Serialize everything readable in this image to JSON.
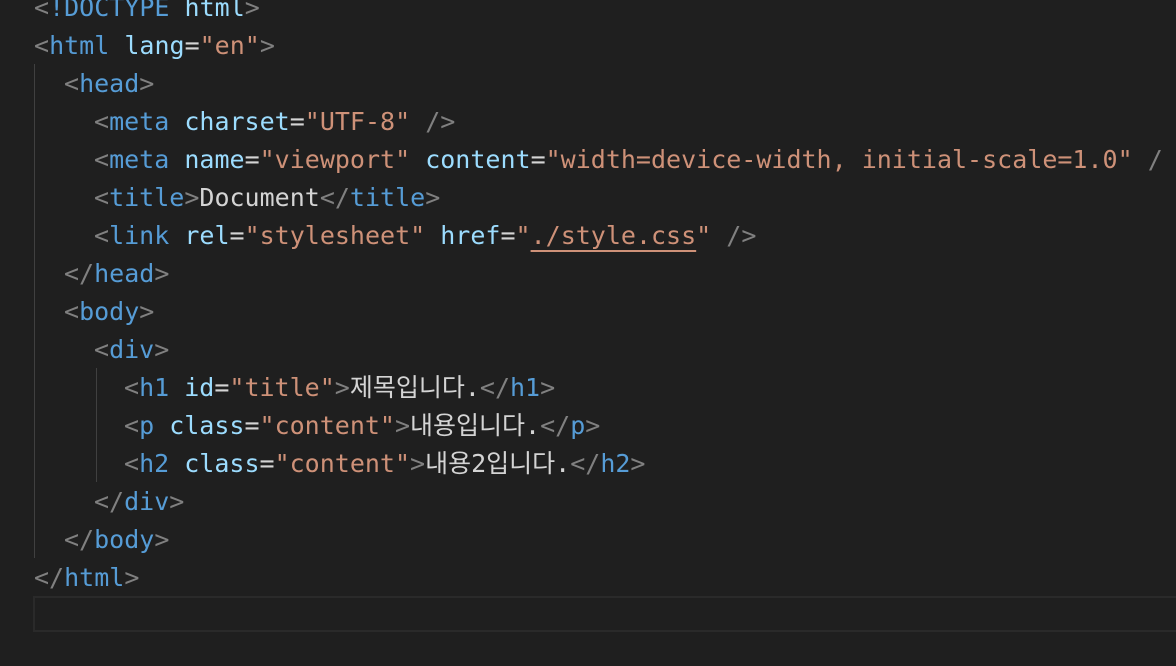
{
  "editor": {
    "lines": [
      {
        "indent": 0,
        "parts": [
          {
            "c": "t",
            "v": "<"
          },
          {
            "c": "tag",
            "v": "!DOCTYPE"
          },
          {
            "c": "txt",
            "v": " "
          },
          {
            "c": "attr",
            "v": "html"
          },
          {
            "c": "t",
            "v": ">"
          }
        ]
      },
      {
        "indent": 0,
        "parts": [
          {
            "c": "t",
            "v": "<"
          },
          {
            "c": "tag",
            "v": "html"
          },
          {
            "c": "txt",
            "v": " "
          },
          {
            "c": "attr",
            "v": "lang"
          },
          {
            "c": "eq",
            "v": "="
          },
          {
            "c": "str",
            "v": "\"en\""
          },
          {
            "c": "t",
            "v": ">"
          }
        ]
      },
      {
        "indent": 1,
        "parts": [
          {
            "c": "t",
            "v": "<"
          },
          {
            "c": "tag",
            "v": "head"
          },
          {
            "c": "t",
            "v": ">"
          }
        ]
      },
      {
        "indent": 2,
        "parts": [
          {
            "c": "t",
            "v": "<"
          },
          {
            "c": "tag",
            "v": "meta"
          },
          {
            "c": "txt",
            "v": " "
          },
          {
            "c": "attr",
            "v": "charset"
          },
          {
            "c": "eq",
            "v": "="
          },
          {
            "c": "str",
            "v": "\"UTF-8\""
          },
          {
            "c": "txt",
            "v": " "
          },
          {
            "c": "t",
            "v": "/>"
          }
        ]
      },
      {
        "indent": 2,
        "parts": [
          {
            "c": "t",
            "v": "<"
          },
          {
            "c": "tag",
            "v": "meta"
          },
          {
            "c": "txt",
            "v": " "
          },
          {
            "c": "attr",
            "v": "name"
          },
          {
            "c": "eq",
            "v": "="
          },
          {
            "c": "str",
            "v": "\"viewport\""
          },
          {
            "c": "txt",
            "v": " "
          },
          {
            "c": "attr",
            "v": "content"
          },
          {
            "c": "eq",
            "v": "="
          },
          {
            "c": "str",
            "v": "\"width=device-width, initial-scale=1.0\""
          },
          {
            "c": "txt",
            "v": " "
          },
          {
            "c": "t",
            "v": "/"
          }
        ]
      },
      {
        "indent": 2,
        "parts": [
          {
            "c": "t",
            "v": "<"
          },
          {
            "c": "tag",
            "v": "title"
          },
          {
            "c": "t",
            "v": ">"
          },
          {
            "c": "txt",
            "v": "Document"
          },
          {
            "c": "t",
            "v": "</"
          },
          {
            "c": "tag",
            "v": "title"
          },
          {
            "c": "t",
            "v": ">"
          }
        ]
      },
      {
        "indent": 2,
        "parts": [
          {
            "c": "t",
            "v": "<"
          },
          {
            "c": "tag",
            "v": "link"
          },
          {
            "c": "txt",
            "v": " "
          },
          {
            "c": "attr",
            "v": "rel"
          },
          {
            "c": "eq",
            "v": "="
          },
          {
            "c": "str",
            "v": "\"stylesheet\""
          },
          {
            "c": "txt",
            "v": " "
          },
          {
            "c": "attr",
            "v": "href"
          },
          {
            "c": "eq",
            "v": "="
          },
          {
            "c": "str",
            "v": "\""
          },
          {
            "c": "str link",
            "v": "./style.css"
          },
          {
            "c": "str",
            "v": "\""
          },
          {
            "c": "txt",
            "v": " "
          },
          {
            "c": "t",
            "v": "/>"
          }
        ]
      },
      {
        "indent": 1,
        "parts": [
          {
            "c": "t",
            "v": "</"
          },
          {
            "c": "tag",
            "v": "head"
          },
          {
            "c": "t",
            "v": ">"
          }
        ]
      },
      {
        "indent": 1,
        "parts": [
          {
            "c": "t",
            "v": "<"
          },
          {
            "c": "tag",
            "v": "body"
          },
          {
            "c": "t",
            "v": ">"
          }
        ]
      },
      {
        "indent": 2,
        "parts": [
          {
            "c": "t",
            "v": "<"
          },
          {
            "c": "tag",
            "v": "div"
          },
          {
            "c": "t",
            "v": ">"
          }
        ]
      },
      {
        "indent": 3,
        "parts": [
          {
            "c": "t",
            "v": "<"
          },
          {
            "c": "tag",
            "v": "h1"
          },
          {
            "c": "txt",
            "v": " "
          },
          {
            "c": "attr",
            "v": "id"
          },
          {
            "c": "eq",
            "v": "="
          },
          {
            "c": "str",
            "v": "\"title\""
          },
          {
            "c": "t",
            "v": ">"
          },
          {
            "c": "txt",
            "v": "제목입니다."
          },
          {
            "c": "t",
            "v": "</"
          },
          {
            "c": "tag",
            "v": "h1"
          },
          {
            "c": "t",
            "v": ">"
          }
        ]
      },
      {
        "indent": 3,
        "parts": [
          {
            "c": "t",
            "v": "<"
          },
          {
            "c": "tag",
            "v": "p"
          },
          {
            "c": "txt",
            "v": " "
          },
          {
            "c": "attr",
            "v": "class"
          },
          {
            "c": "eq",
            "v": "="
          },
          {
            "c": "str",
            "v": "\"content\""
          },
          {
            "c": "t",
            "v": ">"
          },
          {
            "c": "txt",
            "v": "내용입니다."
          },
          {
            "c": "t",
            "v": "</"
          },
          {
            "c": "tag",
            "v": "p"
          },
          {
            "c": "t",
            "v": ">"
          }
        ]
      },
      {
        "indent": 3,
        "parts": [
          {
            "c": "t",
            "v": "<"
          },
          {
            "c": "tag",
            "v": "h2"
          },
          {
            "c": "txt",
            "v": " "
          },
          {
            "c": "attr",
            "v": "class"
          },
          {
            "c": "eq",
            "v": "="
          },
          {
            "c": "str",
            "v": "\"content\""
          },
          {
            "c": "t",
            "v": ">"
          },
          {
            "c": "txt",
            "v": "내용2입니다."
          },
          {
            "c": "t",
            "v": "</"
          },
          {
            "c": "tag",
            "v": "h2"
          },
          {
            "c": "t",
            "v": ">"
          }
        ]
      },
      {
        "indent": 2,
        "parts": [
          {
            "c": "t",
            "v": "</"
          },
          {
            "c": "tag",
            "v": "div"
          },
          {
            "c": "t",
            "v": ">"
          }
        ]
      },
      {
        "indent": 1,
        "parts": [
          {
            "c": "t",
            "v": "</"
          },
          {
            "c": "tag",
            "v": "body"
          },
          {
            "c": "t",
            "v": ">"
          }
        ]
      },
      {
        "indent": 0,
        "parts": [
          {
            "c": "t",
            "v": "</"
          },
          {
            "c": "tag",
            "v": "html"
          },
          {
            "c": "t",
            "v": ">"
          }
        ]
      }
    ]
  },
  "colors": {
    "background": "#1f1f1f",
    "tag": "#569cd6",
    "attribute": "#9cdcfe",
    "string": "#ce9178",
    "punctuation": "#808080",
    "text": "#d4d4d4"
  }
}
